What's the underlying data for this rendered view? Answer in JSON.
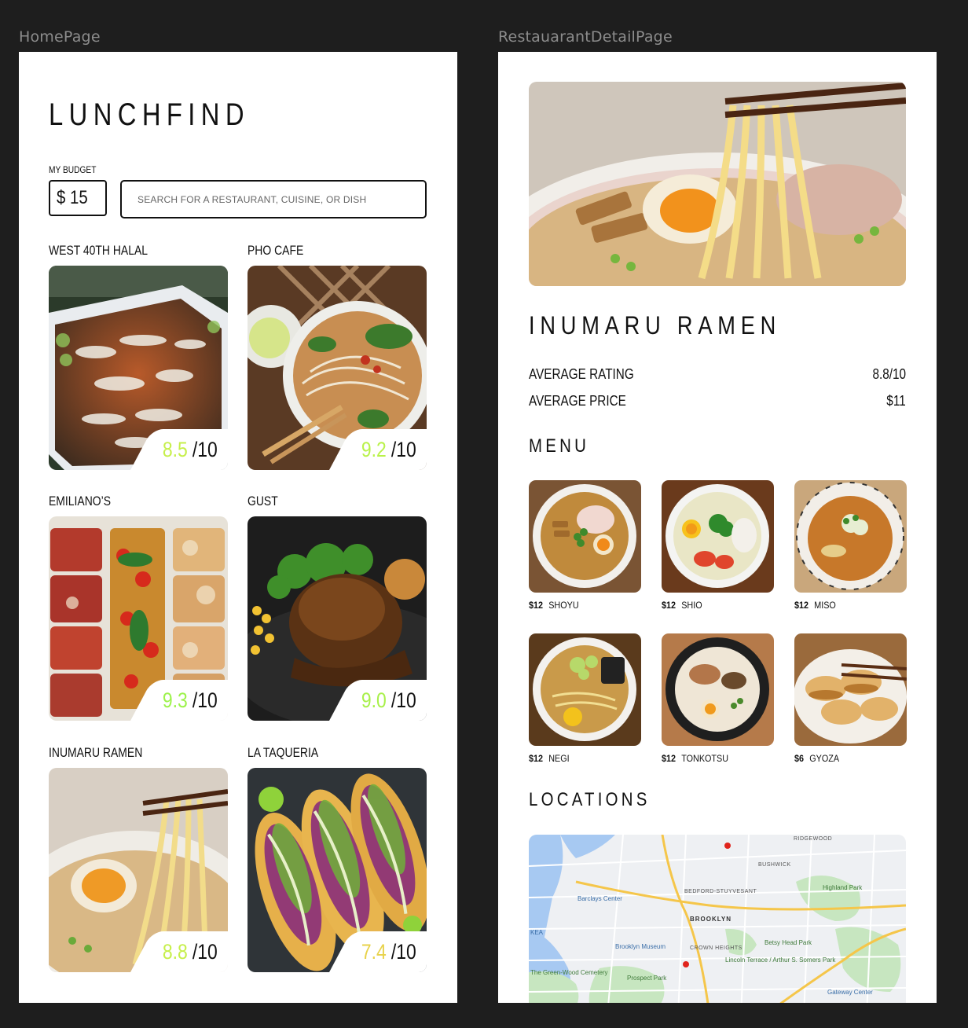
{
  "frames": {
    "home_label": "HomePage",
    "detail_label": "RestauarantDetailPage"
  },
  "home": {
    "app_title": "LUNCHFIND",
    "budget_label": "MY BUDGET",
    "budget_value": "$ 15",
    "search_placeholder": "SEARCH FOR A RESTAURANT, CUISINE, OR DISH",
    "restaurants": [
      {
        "name": "WEST 40TH HALAL",
        "score": "8.5",
        "out_of": "/10",
        "score_color": "#c6ef4a"
      },
      {
        "name": "PHO CAFE",
        "score": "9.2",
        "out_of": "/10",
        "score_color": "#b9f24a"
      },
      {
        "name": "EMILIANO’S",
        "score": "9.3",
        "out_of": "/10",
        "score_color": "#9cf24a"
      },
      {
        "name": "GUST",
        "score": "9.0",
        "out_of": "/10",
        "score_color": "#a8f04a"
      },
      {
        "name": "INUMARU RAMEN",
        "score": "8.8",
        "out_of": "/10",
        "score_color": "#c6ef4a"
      },
      {
        "name": "LA TAQUERIA",
        "score": "7.4",
        "out_of": "/10",
        "score_color": "#e8d24a"
      }
    ]
  },
  "detail": {
    "title": "INUMARU RAMEN",
    "stats": [
      {
        "label": "AVERAGE RATING",
        "value": "8.8/10"
      },
      {
        "label": "AVERAGE PRICE",
        "value": "$11"
      }
    ],
    "menu_title": "MENU",
    "menu": [
      {
        "price": "$12",
        "name": "SHOYU"
      },
      {
        "price": "$12",
        "name": "SHIO"
      },
      {
        "price": "$12",
        "name": "MISO"
      },
      {
        "price": "$12",
        "name": "NEGI"
      },
      {
        "price": "$12",
        "name": "TONKOTSU"
      },
      {
        "price": "$6",
        "name": "GYOZA"
      }
    ],
    "locations_title": "LOCATIONS",
    "map_labels": {
      "ridgewood": "RIDGEWOOD",
      "bushwick": "BUSHWICK",
      "bedstuy": "BEDFORD-STUYVESANT",
      "brooklyn": "BROOKLYN",
      "crown_heights": "CROWN HEIGHTS",
      "barclays": "Barclays Center",
      "highland": "Highland Park",
      "museum": "Brooklyn Museum",
      "betsy": "Betsy Head Park",
      "lincoln": "Lincoln Terrace / Arthur S. Somers Park",
      "prospect": "Prospect Park",
      "greenwood": "The Green-Wood Cemetery",
      "gateway": "Gateway Center",
      "ikea": "KEA"
    }
  }
}
